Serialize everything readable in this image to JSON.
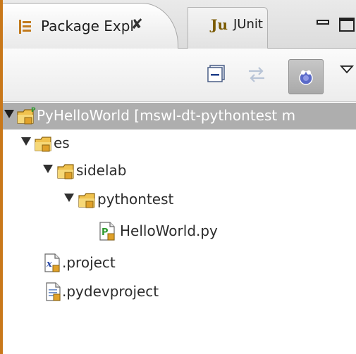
{
  "tabs": [
    {
      "label": "Package Expl",
      "active": true,
      "close_glyph": "✘"
    },
    {
      "label": "JUnit",
      "active": false
    }
  ],
  "junit_icon_text": "Ju",
  "icons": {
    "package_explorer": "package-explorer-icon",
    "close": "close-icon",
    "junit": "junit-icon",
    "minimize": "minimize-icon",
    "maximize": "maximize-icon",
    "collapse_all": "collapse-all-icon",
    "link_with_editor": "link-with-editor-icon",
    "focus_active_task": "focus-active-task-icon",
    "view_menu": "view-menu-icon"
  },
  "tree": [
    {
      "label": "PyHelloWorld [mswl-dt-pythontest m",
      "type": "project",
      "expanded": true,
      "selected": true
    },
    {
      "label": "es",
      "type": "package",
      "expanded": true
    },
    {
      "label": "sidelab",
      "type": "package",
      "expanded": true
    },
    {
      "label": "pythontest",
      "type": "package",
      "expanded": true
    },
    {
      "label": "HelloWorld.py",
      "type": "python-file"
    },
    {
      "label": ".project",
      "type": "xml-file"
    },
    {
      "label": ".pydevproject",
      "type": "text-file"
    }
  ],
  "colors": {
    "selection": "#aeaeae",
    "folder": "#e8b440",
    "python_green": "#2f9a2f",
    "left_edge": "#c9781a"
  }
}
